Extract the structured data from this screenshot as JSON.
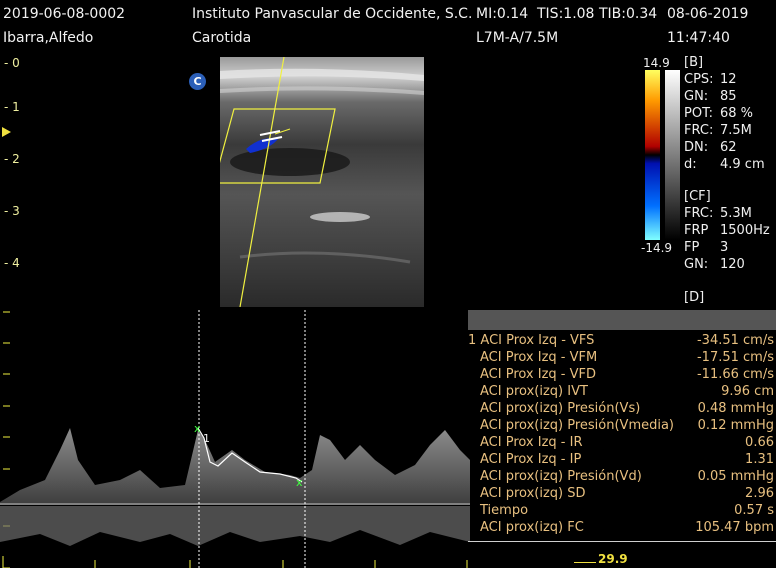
{
  "header": {
    "patient_id": "2019-06-08-0002",
    "institution": "Instituto Panvascular de Occidente, S.C.",
    "mi": "MI:0.14",
    "tis": "TIS:1.08",
    "tib": "TIB:0.34",
    "date": "08-06-2019",
    "patient_name": "Ibarra,Alfedo",
    "exam": "Carotida",
    "probe": "L7M-A/7.5M",
    "time": "11:47:40"
  },
  "depth_scale": [
    "0",
    "1",
    "2",
    "3",
    "4"
  ],
  "mode_badge": "C",
  "colorbar": {
    "max": "14.9",
    "min": "-14.9"
  },
  "params_b": {
    "title": "[B]",
    "items": [
      {
        "k": "CPS:",
        "v": "12"
      },
      {
        "k": "GN:",
        "v": "85"
      },
      {
        "k": "POT:",
        "v": "68 %"
      },
      {
        "k": "FRC:",
        "v": "7.5M"
      },
      {
        "k": "DN:",
        "v": "62"
      },
      {
        "k": "d:",
        "v": "4.9 cm"
      }
    ]
  },
  "params_cf": {
    "title": "[CF]",
    "items": [
      {
        "k": "FRC:",
        "v": "5.3M"
      },
      {
        "k": "FRP",
        "v": "1500Hz"
      },
      {
        "k": "FP",
        "v": "3"
      },
      {
        "k": "GN:",
        "v": "120"
      }
    ]
  },
  "params_d": {
    "title": "[D]"
  },
  "spectral": {
    "marker_label": "1",
    "velocity_scale": "29.9"
  },
  "measurements": [
    {
      "label": "1 ACI Prox Izq - VFS",
      "value": "-34.51 cm/s"
    },
    {
      "label": "ACI Prox Izq - VFM",
      "value": "-17.51 cm/s"
    },
    {
      "label": "ACI Prox Izq - VFD",
      "value": "-11.66 cm/s"
    },
    {
      "label": "ACI prox(izq) IVT",
      "value": "9.96 cm"
    },
    {
      "label": "ACI prox(izq) Presión(Vs)",
      "value": "0.48 mmHg"
    },
    {
      "label": "ACI prox(izq) Presión(Vmedia)",
      "value": "0.12 mmHg"
    },
    {
      "label": "ACI Prox Izq - IR",
      "value": "0.66"
    },
    {
      "label": "ACI Prox Izq - IP",
      "value": "1.31"
    },
    {
      "label": "ACI prox(izq) Presión(Vd)",
      "value": "0.05 mmHg"
    },
    {
      "label": "ACI prox(izq) SD",
      "value": "2.96"
    },
    {
      "label": "Tiempo",
      "value": "0.57 s"
    },
    {
      "label": "ACI prox(izq) FC",
      "value": "105.47 bpm"
    }
  ]
}
